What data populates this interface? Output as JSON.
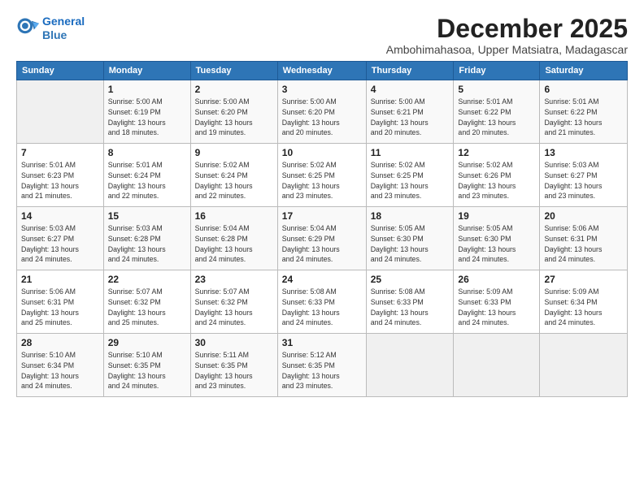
{
  "header": {
    "logo_line1": "General",
    "logo_line2": "Blue",
    "title": "December 2025",
    "subtitle": "Ambohimahasoa, Upper Matsiatra, Madagascar"
  },
  "weekdays": [
    "Sunday",
    "Monday",
    "Tuesday",
    "Wednesday",
    "Thursday",
    "Friday",
    "Saturday"
  ],
  "weeks": [
    [
      {
        "day": "",
        "info": ""
      },
      {
        "day": "1",
        "info": "Sunrise: 5:00 AM\nSunset: 6:19 PM\nDaylight: 13 hours\nand 18 minutes."
      },
      {
        "day": "2",
        "info": "Sunrise: 5:00 AM\nSunset: 6:20 PM\nDaylight: 13 hours\nand 19 minutes."
      },
      {
        "day": "3",
        "info": "Sunrise: 5:00 AM\nSunset: 6:20 PM\nDaylight: 13 hours\nand 20 minutes."
      },
      {
        "day": "4",
        "info": "Sunrise: 5:00 AM\nSunset: 6:21 PM\nDaylight: 13 hours\nand 20 minutes."
      },
      {
        "day": "5",
        "info": "Sunrise: 5:01 AM\nSunset: 6:22 PM\nDaylight: 13 hours\nand 20 minutes."
      },
      {
        "day": "6",
        "info": "Sunrise: 5:01 AM\nSunset: 6:22 PM\nDaylight: 13 hours\nand 21 minutes."
      }
    ],
    [
      {
        "day": "7",
        "info": "Sunrise: 5:01 AM\nSunset: 6:23 PM\nDaylight: 13 hours\nand 21 minutes."
      },
      {
        "day": "8",
        "info": "Sunrise: 5:01 AM\nSunset: 6:24 PM\nDaylight: 13 hours\nand 22 minutes."
      },
      {
        "day": "9",
        "info": "Sunrise: 5:02 AM\nSunset: 6:24 PM\nDaylight: 13 hours\nand 22 minutes."
      },
      {
        "day": "10",
        "info": "Sunrise: 5:02 AM\nSunset: 6:25 PM\nDaylight: 13 hours\nand 23 minutes."
      },
      {
        "day": "11",
        "info": "Sunrise: 5:02 AM\nSunset: 6:25 PM\nDaylight: 13 hours\nand 23 minutes."
      },
      {
        "day": "12",
        "info": "Sunrise: 5:02 AM\nSunset: 6:26 PM\nDaylight: 13 hours\nand 23 minutes."
      },
      {
        "day": "13",
        "info": "Sunrise: 5:03 AM\nSunset: 6:27 PM\nDaylight: 13 hours\nand 23 minutes."
      }
    ],
    [
      {
        "day": "14",
        "info": "Sunrise: 5:03 AM\nSunset: 6:27 PM\nDaylight: 13 hours\nand 24 minutes."
      },
      {
        "day": "15",
        "info": "Sunrise: 5:03 AM\nSunset: 6:28 PM\nDaylight: 13 hours\nand 24 minutes."
      },
      {
        "day": "16",
        "info": "Sunrise: 5:04 AM\nSunset: 6:28 PM\nDaylight: 13 hours\nand 24 minutes."
      },
      {
        "day": "17",
        "info": "Sunrise: 5:04 AM\nSunset: 6:29 PM\nDaylight: 13 hours\nand 24 minutes."
      },
      {
        "day": "18",
        "info": "Sunrise: 5:05 AM\nSunset: 6:30 PM\nDaylight: 13 hours\nand 24 minutes."
      },
      {
        "day": "19",
        "info": "Sunrise: 5:05 AM\nSunset: 6:30 PM\nDaylight: 13 hours\nand 24 minutes."
      },
      {
        "day": "20",
        "info": "Sunrise: 5:06 AM\nSunset: 6:31 PM\nDaylight: 13 hours\nand 24 minutes."
      }
    ],
    [
      {
        "day": "21",
        "info": "Sunrise: 5:06 AM\nSunset: 6:31 PM\nDaylight: 13 hours\nand 25 minutes."
      },
      {
        "day": "22",
        "info": "Sunrise: 5:07 AM\nSunset: 6:32 PM\nDaylight: 13 hours\nand 25 minutes."
      },
      {
        "day": "23",
        "info": "Sunrise: 5:07 AM\nSunset: 6:32 PM\nDaylight: 13 hours\nand 24 minutes."
      },
      {
        "day": "24",
        "info": "Sunrise: 5:08 AM\nSunset: 6:33 PM\nDaylight: 13 hours\nand 24 minutes."
      },
      {
        "day": "25",
        "info": "Sunrise: 5:08 AM\nSunset: 6:33 PM\nDaylight: 13 hours\nand 24 minutes."
      },
      {
        "day": "26",
        "info": "Sunrise: 5:09 AM\nSunset: 6:33 PM\nDaylight: 13 hours\nand 24 minutes."
      },
      {
        "day": "27",
        "info": "Sunrise: 5:09 AM\nSunset: 6:34 PM\nDaylight: 13 hours\nand 24 minutes."
      }
    ],
    [
      {
        "day": "28",
        "info": "Sunrise: 5:10 AM\nSunset: 6:34 PM\nDaylight: 13 hours\nand 24 minutes."
      },
      {
        "day": "29",
        "info": "Sunrise: 5:10 AM\nSunset: 6:35 PM\nDaylight: 13 hours\nand 24 minutes."
      },
      {
        "day": "30",
        "info": "Sunrise: 5:11 AM\nSunset: 6:35 PM\nDaylight: 13 hours\nand 23 minutes."
      },
      {
        "day": "31",
        "info": "Sunrise: 5:12 AM\nSunset: 6:35 PM\nDaylight: 13 hours\nand 23 minutes."
      },
      {
        "day": "",
        "info": ""
      },
      {
        "day": "",
        "info": ""
      },
      {
        "day": "",
        "info": ""
      }
    ]
  ]
}
